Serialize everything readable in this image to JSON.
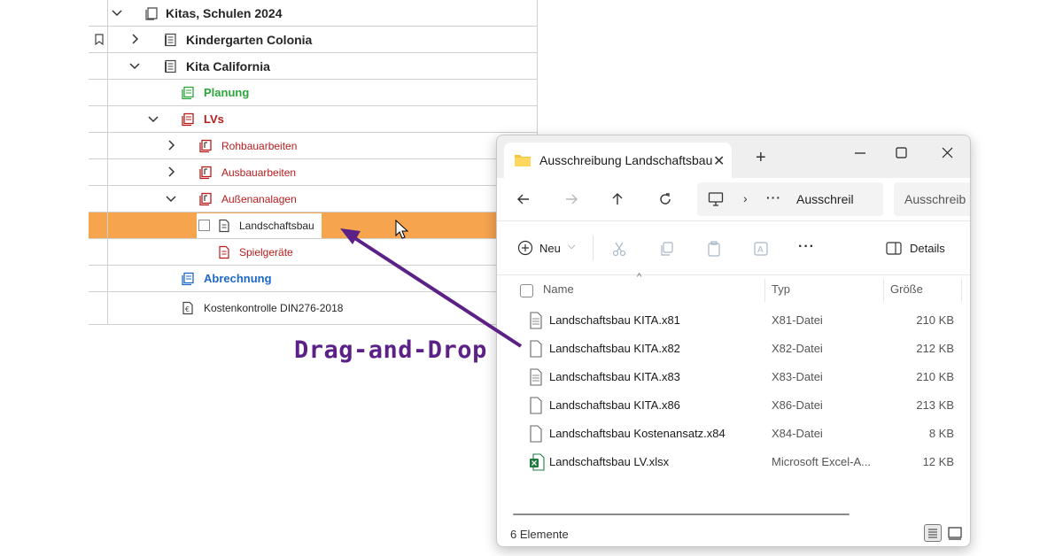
{
  "tree": {
    "items": [
      {
        "label": "Kitas, Schulen 2024"
      },
      {
        "label": "Kindergarten Colonia"
      },
      {
        "label": "Kita California"
      },
      {
        "label": "Planung"
      },
      {
        "label": "LVs"
      },
      {
        "label": "Rohbauarbeiten"
      },
      {
        "label": "Ausbauarbeiten"
      },
      {
        "label": "Außenanalagen"
      },
      {
        "label": "Landschaftsbau"
      },
      {
        "label": "Spielgeräte"
      },
      {
        "label": "Abrechnung"
      },
      {
        "label": "Kostenkontrolle DIN276-2018"
      }
    ]
  },
  "annotation": {
    "text": "Drag-and-Drop"
  },
  "explorer": {
    "tab_title": "Ausschreibung Landschaftsbau",
    "address": "Ausschreil",
    "search_text": "Ausschreib",
    "new_label": "Neu",
    "details_label": "Details",
    "columns": {
      "name": "Name",
      "type": "Typ",
      "size": "Größe"
    },
    "files": [
      {
        "name": "Landschaftsbau KITA.x81",
        "type": "X81-Datei",
        "size": "210 KB"
      },
      {
        "name": "Landschaftsbau KITA.x82",
        "type": "X82-Datei",
        "size": "212 KB"
      },
      {
        "name": "Landschaftsbau KITA.x83",
        "type": "X83-Datei",
        "size": "210 KB"
      },
      {
        "name": "Landschaftsbau KITA.x86",
        "type": "X86-Datei",
        "size": "213 KB"
      },
      {
        "name": "Landschaftsbau Kostenansatz.x84",
        "type": "X84-Datei",
        "size": "8 KB"
      },
      {
        "name": "Landschaftsbau LV.xlsx",
        "type": "Microsoft Excel-A...",
        "size": "12 KB"
      }
    ],
    "status": "6 Elemente"
  },
  "colors": {
    "selection": "#f6a44e",
    "annotation": "#5b2187",
    "green": "#2aa63a",
    "red": "#b81d1d",
    "blue": "#1e68c7"
  }
}
